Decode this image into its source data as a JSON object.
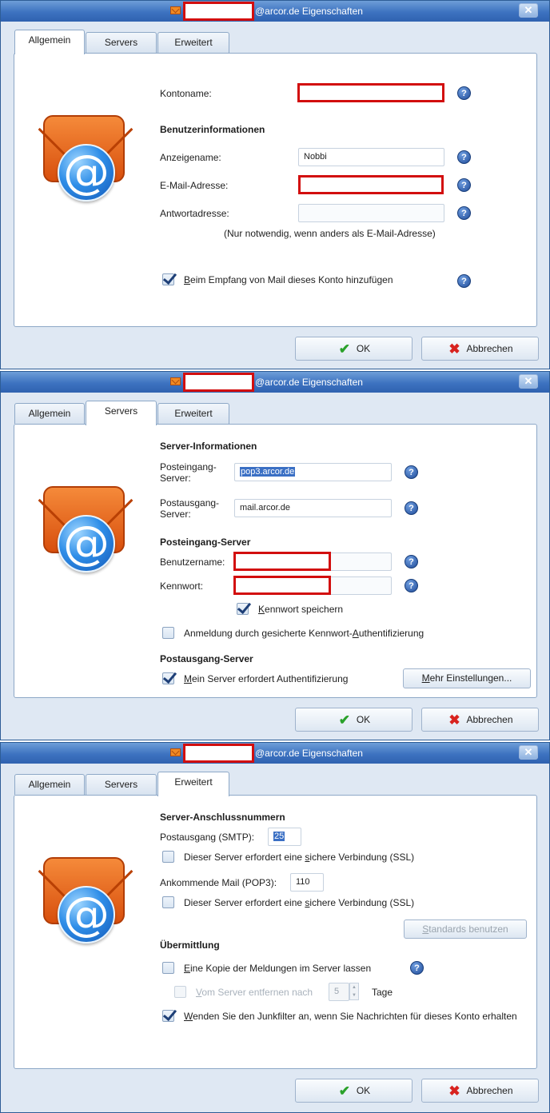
{
  "title_suffix": "@arcor.de Eigenschaften",
  "close_glyph": "✕",
  "tabs": {
    "general": "Allgemein",
    "servers": "Servers",
    "advanced": "Erweitert"
  },
  "help_glyph": "?",
  "buttons": {
    "ok": "OK",
    "cancel": "Abbrechen",
    "ok_icon": "✔",
    "cancel_icon": "✖"
  },
  "general": {
    "account_name_label": "Kontoname:",
    "user_info_header": "Benutzerinformationen",
    "display_name_label": "Anzeigename:",
    "display_name_value": "Nobbi",
    "email_label": "E-Mail-Adresse:",
    "reply_label": "Antwortadresse:",
    "reply_hint": "(Nur notwendig, wenn anders als E-Mail-Adresse)",
    "include_check_label_u": "B",
    "include_check_label_rest": "eim Empfang von Mail dieses Konto hinzufügen"
  },
  "servers": {
    "server_info_header": "Server-Informationen",
    "incoming_label_1": "Posteingang-",
    "incoming_label_2": "Server:",
    "incoming_value": "pop3.arcor.de",
    "outgoing_label_1": "Postausgang-",
    "outgoing_label_2": "Server:",
    "outgoing_value": "mail.arcor.de",
    "incoming_header": "Posteingang-Server",
    "username_label": "Benutzername:",
    "password_label": "Kennwort:",
    "save_password_u": "K",
    "save_password_rest": "ennwort speichern",
    "spa_pre": "Anmeldung durch gesicherte Kennwort-",
    "spa_u": "A",
    "spa_post": "uthentifizierung",
    "outgoing_header": "Postausgang-Server",
    "auth_required_u": "M",
    "auth_required_rest": "ein Server erfordert Authentifizierung",
    "more_settings_u": "M",
    "more_settings_rest": "ehr Einstellungen..."
  },
  "advanced": {
    "ports_header": "Server-Anschlussnummern",
    "smtp_label": "Postausgang (SMTP):",
    "smtp_value": "25",
    "ssl_pre": "Dieser Server erfordert eine ",
    "ssl_u": "s",
    "ssl_post": "ichere Verbindung (SSL)",
    "pop3_label": "Ankommende Mail (POP3):",
    "pop3_value": "110",
    "defaults_u": "S",
    "defaults_rest": "tandards benutzen",
    "delivery_header": "Übermittlung",
    "keep_copy_u": "E",
    "keep_copy_rest": "ine Kopie der Meldungen im Server lassen",
    "remove_after_u": "V",
    "remove_after_rest": "om Server entfernen nach",
    "days_value": "5",
    "days_label": "Tage",
    "junk_u": "W",
    "junk_rest": "enden Sie den Junkfilter an, wenn Sie Nachrichten für dieses Konto erhalten"
  }
}
